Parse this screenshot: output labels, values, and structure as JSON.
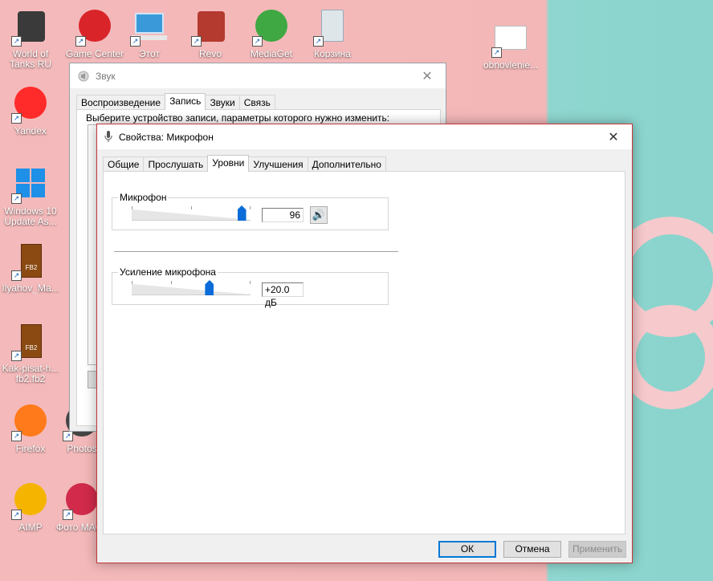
{
  "desktop": {
    "icons": [
      {
        "name": "world-of-tanks",
        "label": "World of Tanks RU",
        "icon": "tank-icon",
        "color": "#3a3a3a"
      },
      {
        "name": "game-center",
        "label": "Game Center",
        "icon": "game-center-icon",
        "color": "#d9242a"
      },
      {
        "name": "this-pc",
        "label": "Этот",
        "icon": "computer-icon",
        "color": "#3a9ad9"
      },
      {
        "name": "revo",
        "label": "Revo",
        "icon": "revo-icon",
        "color": "#b43a2f"
      },
      {
        "name": "mediaget",
        "label": "MediaGet",
        "icon": "mediaget-icon",
        "color": "#3fa843"
      },
      {
        "name": "recycle-bin",
        "label": "Корзина",
        "icon": "recycle-bin-icon",
        "color": "#dfe6ea"
      },
      {
        "name": "obnovlenie",
        "label": "obnovlenie...",
        "icon": "file-icon",
        "color": "#ffffff"
      },
      {
        "name": "yandex",
        "label": "Yandex",
        "icon": "yandex-icon",
        "color": "#ff2a2a"
      },
      {
        "name": "windows-update",
        "label": "Windows 10 Update As...",
        "icon": "windows-icon",
        "color": "#1e90e8"
      },
      {
        "name": "fb2-ilyahov",
        "label": "Ilyahov_Ma...",
        "icon": "fb2-book-icon",
        "color": "#8a4a12"
      },
      {
        "name": "fb2-kak-pisat",
        "label": "Kak-pisat-h... fb2.fb2",
        "icon": "fb2-book-icon",
        "color": "#8a4a12"
      },
      {
        "name": "firefox",
        "label": "Firefox",
        "icon": "firefox-icon",
        "color": "#ff7a1a"
      },
      {
        "name": "photos",
        "label": "Photos",
        "icon": "photos-icon",
        "color": "#444444"
      },
      {
        "name": "aimp",
        "label": "AIMP",
        "icon": "aimp-icon",
        "color": "#f5b400"
      },
      {
        "name": "foto-master",
        "label": "Фото МАСТ",
        "icon": "photo-master-icon",
        "color": "#d12a4a"
      }
    ],
    "fb2_label": "FB2"
  },
  "sound_window": {
    "title": "Звук",
    "tabs": [
      "Воспроизведение",
      "Запись",
      "Звуки",
      "Связь"
    ],
    "active_tab": "Запись",
    "message": "Выберите устройство записи, параметры которого нужно изменить:"
  },
  "properties_window": {
    "title": "Свойства: Микрофон",
    "tabs": [
      "Общие",
      "Прослушать",
      "Уровни",
      "Улучшения",
      "Дополнительно"
    ],
    "active_tab": "Уровни",
    "microphone": {
      "label": "Микрофон",
      "level": 96,
      "value_text": "96"
    },
    "boost": {
      "label": "Усиление микрофона",
      "level_fraction": 0.667,
      "value_text": "+20.0 дБ"
    },
    "buttons": {
      "ok": "ОК",
      "cancel": "Отмена",
      "apply": "Применить"
    }
  },
  "colors": {
    "accent": "#0078d7",
    "slider_thumb": "#0a6cd8",
    "active_border": "#c4383b"
  }
}
